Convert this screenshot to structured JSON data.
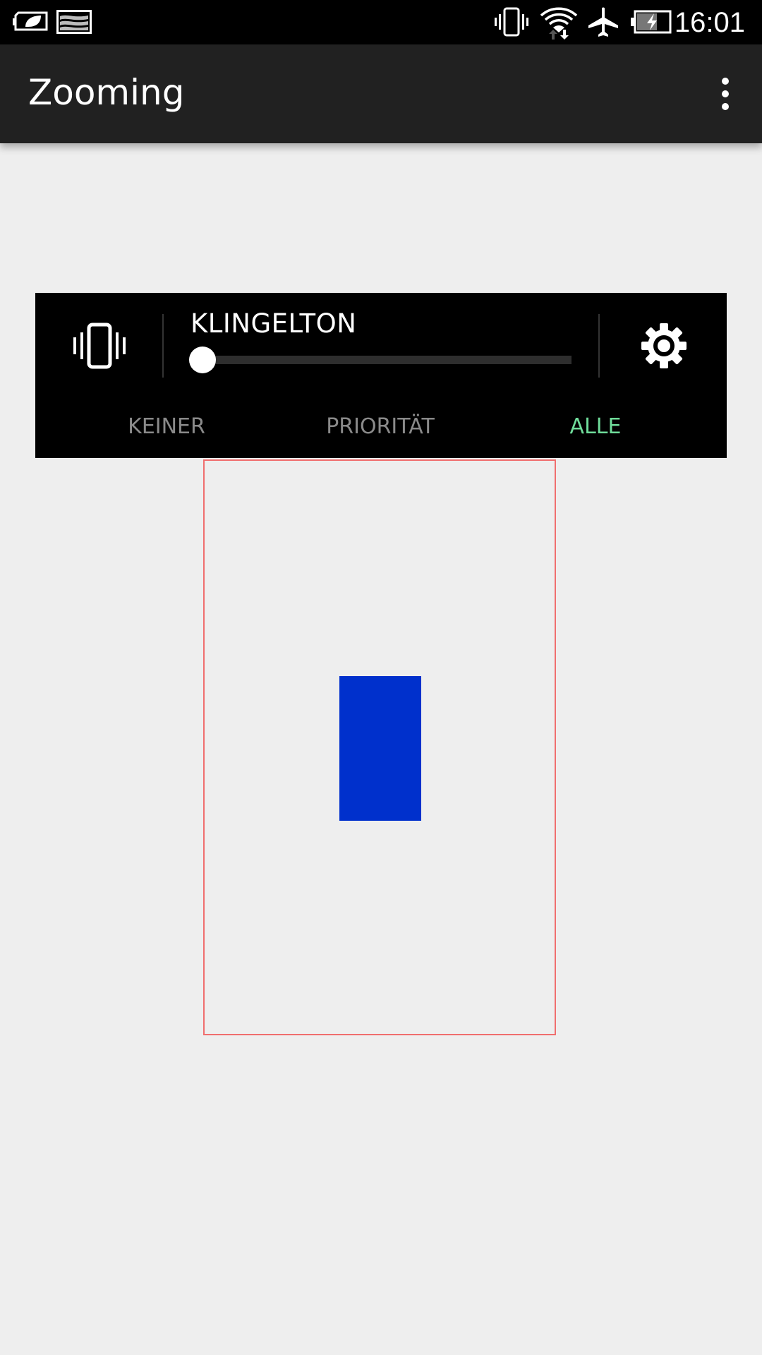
{
  "status_bar": {
    "time": "16:01",
    "icons": [
      "battery-saver-icon",
      "image-notification-icon",
      "vibrate-icon",
      "wifi-icon",
      "airplane-icon",
      "battery-charging-icon"
    ]
  },
  "app_bar": {
    "title": "Zooming",
    "menu_icon": "overflow-menu-icon"
  },
  "volume_panel": {
    "stream_label": "KLINGELTON",
    "volume_level": 0,
    "modes": [
      {
        "label": "KEINER",
        "selected": false
      },
      {
        "label": "PRIORITÄT",
        "selected": false
      },
      {
        "label": "ALLE",
        "selected": true
      }
    ],
    "left_icon": "vibrate-icon",
    "right_icon": "gear-icon"
  },
  "colors": {
    "status_bar": "#000000",
    "app_bar": "#212121",
    "background": "#eeeeee",
    "panel": "#000000",
    "tab_inactive": "#8a8a8a",
    "tab_selected": "#6fdc9a",
    "frame_border": "#f06e6e",
    "shape_fill": "#0030cc"
  }
}
